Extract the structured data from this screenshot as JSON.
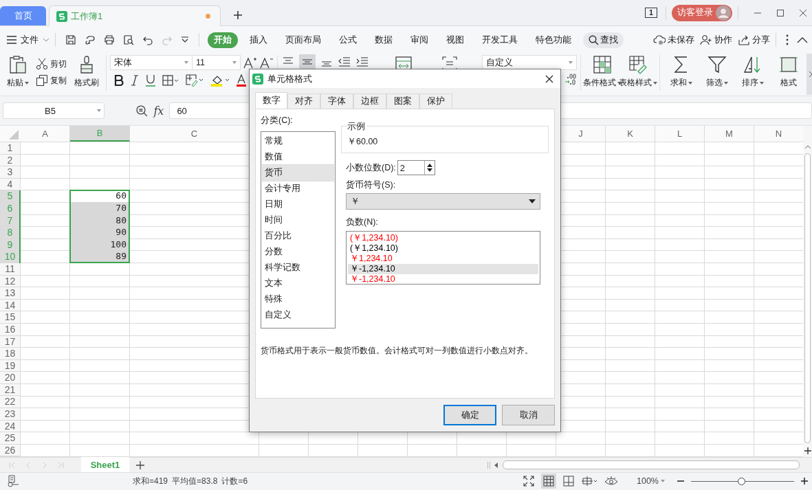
{
  "title_bar": {
    "tabs": [
      {
        "label": "首页",
        "kind": "home",
        "selected": false
      },
      {
        "label": "工作簿1",
        "kind": "document",
        "selected": true,
        "unsaved": true
      }
    ],
    "page_count": "1",
    "login": "访客登录"
  },
  "menu_bar": {
    "file": "文件",
    "tabs": [
      {
        "label": "开始",
        "selected": true
      },
      {
        "label": "插入",
        "selected": false
      },
      {
        "label": "页面布局",
        "selected": false
      },
      {
        "label": "公式",
        "selected": false
      },
      {
        "label": "数据",
        "selected": false
      },
      {
        "label": "审阅",
        "selected": false
      },
      {
        "label": "视图",
        "selected": false
      },
      {
        "label": "开发工具",
        "selected": false
      },
      {
        "label": "特色功能",
        "selected": false
      }
    ],
    "search": "查找",
    "actions": [
      {
        "label": "未保存",
        "kind": "cloud"
      },
      {
        "label": "协作",
        "kind": "person"
      },
      {
        "label": "分享",
        "kind": "share"
      }
    ]
  },
  "ribbon": {
    "paste": "粘贴",
    "cut": "剪切",
    "copy": "复制",
    "format_painter": "格式刷",
    "font_name": "宋体",
    "font_size": "11",
    "number_format": "自定义",
    "tools": [
      {
        "label": "条件格式",
        "kind": "conditional"
      },
      {
        "label": "表格样式",
        "kind": "table"
      },
      {
        "label": "求和",
        "kind": "sum"
      },
      {
        "label": "筛选",
        "kind": "filter"
      },
      {
        "label": "排序",
        "kind": "sort"
      },
      {
        "label": "格式",
        "kind": "format"
      }
    ]
  },
  "formula_bar": {
    "cell": "B5",
    "fx": "fx",
    "value": "60"
  },
  "sheet": {
    "columns": [
      {
        "label": "A",
        "selected": false
      },
      {
        "label": "B",
        "selected": true
      },
      {
        "label": "C",
        "selected": false
      },
      {
        "label": "J",
        "selected": false
      },
      {
        "label": "K",
        "selected": false
      },
      {
        "label": "L",
        "selected": false
      },
      {
        "label": "M",
        "selected": false
      },
      {
        "label": "N",
        "selected": false
      }
    ],
    "rows": [
      {
        "label": "1",
        "selected": false
      },
      {
        "label": "2",
        "selected": false
      },
      {
        "label": "3",
        "selected": false
      },
      {
        "label": "4",
        "selected": false
      },
      {
        "label": "5",
        "selected": true,
        "active": true,
        "value": "60"
      },
      {
        "label": "6",
        "selected": true,
        "active": false,
        "value": "70"
      },
      {
        "label": "7",
        "selected": true,
        "active": false,
        "value": "80"
      },
      {
        "label": "8",
        "selected": true,
        "active": false,
        "value": "90"
      },
      {
        "label": "9",
        "selected": true,
        "active": false,
        "value": "100"
      },
      {
        "label": "10",
        "selected": true,
        "active": false,
        "value": "89"
      },
      {
        "label": "11",
        "selected": false
      },
      {
        "label": "12",
        "selected": false
      },
      {
        "label": "13",
        "selected": false
      },
      {
        "label": "14",
        "selected": false
      },
      {
        "label": "15",
        "selected": false
      },
      {
        "label": "16",
        "selected": false
      },
      {
        "label": "17",
        "selected": false
      },
      {
        "label": "18",
        "selected": false
      },
      {
        "label": "19",
        "selected": false
      },
      {
        "label": "20",
        "selected": false
      },
      {
        "label": "21",
        "selected": false
      },
      {
        "label": "22",
        "selected": false
      },
      {
        "label": "23",
        "selected": false
      },
      {
        "label": "24",
        "selected": false
      },
      {
        "label": "25",
        "selected": false
      },
      {
        "label": "26",
        "selected": false
      }
    ]
  },
  "sheet_tabs": [
    {
      "label": "Sheet1",
      "selected": true
    }
  ],
  "status_bar": {
    "stats": [
      "求和=419",
      "平均值=83.8",
      "计数=6"
    ],
    "zoom": "100%",
    "level": 0.49
  },
  "dialog": {
    "title": "单元格格式",
    "tabs": [
      {
        "label": "数字",
        "selected": true
      },
      {
        "label": "对齐",
        "selected": false
      },
      {
        "label": "字体",
        "selected": false
      },
      {
        "label": "边框",
        "selected": false
      },
      {
        "label": "图案",
        "selected": false
      },
      {
        "label": "保护",
        "selected": false
      }
    ],
    "category_label": "分类(C):",
    "categories": [
      {
        "label": "常规",
        "selected": false
      },
      {
        "label": "数值",
        "selected": false
      },
      {
        "label": "货币",
        "selected": true
      },
      {
        "label": "会计专用",
        "selected": false
      },
      {
        "label": "日期",
        "selected": false
      },
      {
        "label": "时间",
        "selected": false
      },
      {
        "label": "百分比",
        "selected": false
      },
      {
        "label": "分数",
        "selected": false
      },
      {
        "label": "科学记数",
        "selected": false
      },
      {
        "label": "文本",
        "selected": false
      },
      {
        "label": "特殊",
        "selected": false
      },
      {
        "label": "自定义",
        "selected": false
      }
    ],
    "sample_label": "示例",
    "sample": "￥60.00",
    "decimals_label": "小数位数(D):",
    "decimals": "2",
    "symbol_label": "货币符号(S):",
    "symbol": "￥",
    "negative_label": "负数(N):",
    "negatives": [
      {
        "label": "(￥1,234.10)",
        "color": "#ff0000",
        "selected": false
      },
      {
        "label": "(￥1,234.10)",
        "color": "#000000",
        "selected": false
      },
      {
        "label": "￥1,234.10",
        "color": "#ff0000",
        "selected": false
      },
      {
        "label": "￥-1,234.10",
        "color": "#000000",
        "selected": true
      },
      {
        "label": "￥-1,234.10",
        "color": "#ff0000",
        "selected": false
      }
    ],
    "description": "货币格式用于表示一般货币数值。会计格式可对一列数值进行小数点对齐。",
    "buttons": [
      {
        "label": "确定",
        "kind": "primary"
      },
      {
        "label": "取消",
        "kind": "secondary"
      }
    ]
  }
}
